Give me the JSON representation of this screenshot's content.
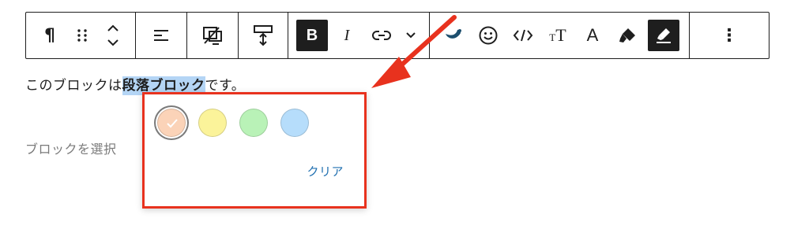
{
  "toolbar": {
    "groups": [
      [
        "paragraph-icon",
        "drag-handle-icon",
        "move-up-down-icon"
      ],
      [
        "align-left-icon"
      ],
      [
        "responsive-icon"
      ],
      [
        "spacing-icon"
      ],
      [
        "bold-icon",
        "italic-icon",
        "link-icon",
        "chevron-down-icon"
      ],
      [
        "custom-style-icon",
        "emoji-icon",
        "code-icon",
        "font-size-icon",
        "text-color-icon",
        "highlighter-icon",
        "marker-icon"
      ],
      [
        "more-options-icon"
      ]
    ],
    "bold_label": "B",
    "italic_label": "I",
    "font_size_label": "TT",
    "text_color_label": "A",
    "more_label": "⋮"
  },
  "content": {
    "para_before": "このブロックは",
    "para_highlight": "段落ブロック",
    "para_after": "です。",
    "placeholder": "ブロックを選択"
  },
  "popover": {
    "swatches": [
      {
        "name": "orange",
        "color": "#fbd3b8",
        "selected": true
      },
      {
        "name": "yellow",
        "color": "#fbf39a",
        "selected": false
      },
      {
        "name": "green",
        "color": "#b9f2b7",
        "selected": false
      },
      {
        "name": "blue",
        "color": "#b6ddfb",
        "selected": false
      }
    ],
    "clear_label": "クリア"
  },
  "colors": {
    "accent_red": "#e8321e",
    "link_blue": "#2271b1",
    "text_highlight": "#b4d5f5"
  }
}
